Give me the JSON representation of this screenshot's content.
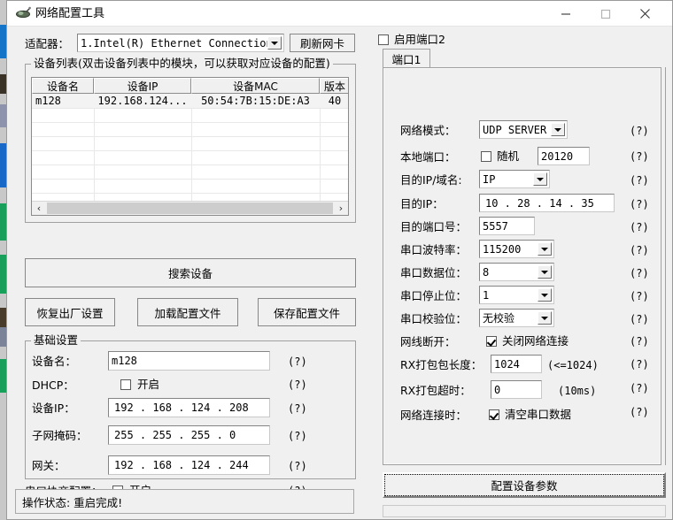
{
  "window": {
    "title": "网络配置工具",
    "icon": "app-icon",
    "minimize_label": "—",
    "maximize_label": "▢",
    "close_label": "✕"
  },
  "adapter": {
    "label": "适配器：",
    "value": "1.Intel(R) Ethernet Connection",
    "refresh_button": "刷新网卡"
  },
  "device_list": {
    "caption": "设备列表(双击设备列表中的模块，可以获取对应设备的配置)",
    "columns": [
      "设备名",
      "设备IP",
      "设备MAC",
      "版本"
    ],
    "rows": [
      {
        "name": "m128",
        "ip": "192.168.124...",
        "mac": "50:54:7B:15:DE:A3",
        "version": "40"
      }
    ],
    "scroll_left": "‹",
    "scroll_right": "›"
  },
  "actions": {
    "search_device": "搜索设备",
    "restore_factory": "恢复出厂设置",
    "load_config": "加载配置文件",
    "save_config": "保存配置文件"
  },
  "basic_settings": {
    "caption": "基础设置",
    "device_name": {
      "label": "设备名：",
      "value": "m128",
      "help": "(?)"
    },
    "dhcp": {
      "label": "DHCP：",
      "checkbox_label": "开启",
      "checked": false,
      "help": "(?)"
    },
    "device_ip": {
      "label": "设备IP：",
      "value": "192 . 168 . 124 . 208",
      "help": "(?)"
    },
    "subnet_mask": {
      "label": "子网掩码：",
      "value": "255 . 255 . 255 .   0",
      "help": "(?)"
    },
    "gateway": {
      "label": "网关：",
      "value": "192 . 168 . 124 . 244",
      "help": "(?)"
    },
    "serial_negotiation": {
      "label": "串口协商配置：",
      "checkbox_label": "开启",
      "checked": true,
      "help": "(?)"
    }
  },
  "port_panel": {
    "enable_port2": {
      "label": "启用端口2",
      "checked": false
    },
    "tab_label": "端口1",
    "fields": {
      "net_mode": {
        "label": "网络模式：",
        "value": "UDP SERVER",
        "help": "(?)"
      },
      "local_port": {
        "label": "本地端口：",
        "random_label": "随机",
        "random_checked": false,
        "value": "20120",
        "help": "(?)"
      },
      "dest_type": {
        "label": "目的IP/域名:",
        "value": "IP",
        "help": "(?)"
      },
      "dest_ip": {
        "label": "目的IP：",
        "value": " 10 . 28 . 14 . 35",
        "help": "(?)"
      },
      "dest_port": {
        "label": "目的端口号：",
        "value": "5557",
        "help": "(?)"
      },
      "baud": {
        "label": "串口波特率：",
        "value": "115200",
        "help": "(?)"
      },
      "databits": {
        "label": "串口数据位：",
        "value": "8",
        "help": "(?)"
      },
      "stopbits": {
        "label": "串口停止位：",
        "value": "1",
        "help": "(?)"
      },
      "parity": {
        "label": "串口校验位：",
        "value": "无校验",
        "help": "(?)"
      },
      "cable_disconnect": {
        "label": "网线断开：",
        "checkbox_label": "关闭网络连接",
        "checked": true,
        "help": "(?)"
      },
      "rx_pack_len": {
        "label": "RX打包包长度：",
        "value": "1024",
        "hint": "(<=1024)",
        "help": "(?)"
      },
      "rx_pack_timeout": {
        "label": "RX打包超时：",
        "value": "0",
        "hint": "(10ms)",
        "help": "(?)"
      },
      "on_connect": {
        "label": "网络连接时：",
        "checkbox_label": "清空串口数据",
        "checked": true,
        "help": "(?)"
      }
    },
    "apply_button": "配置设备参数"
  },
  "status": {
    "text": "操作状态: 重启完成!"
  }
}
